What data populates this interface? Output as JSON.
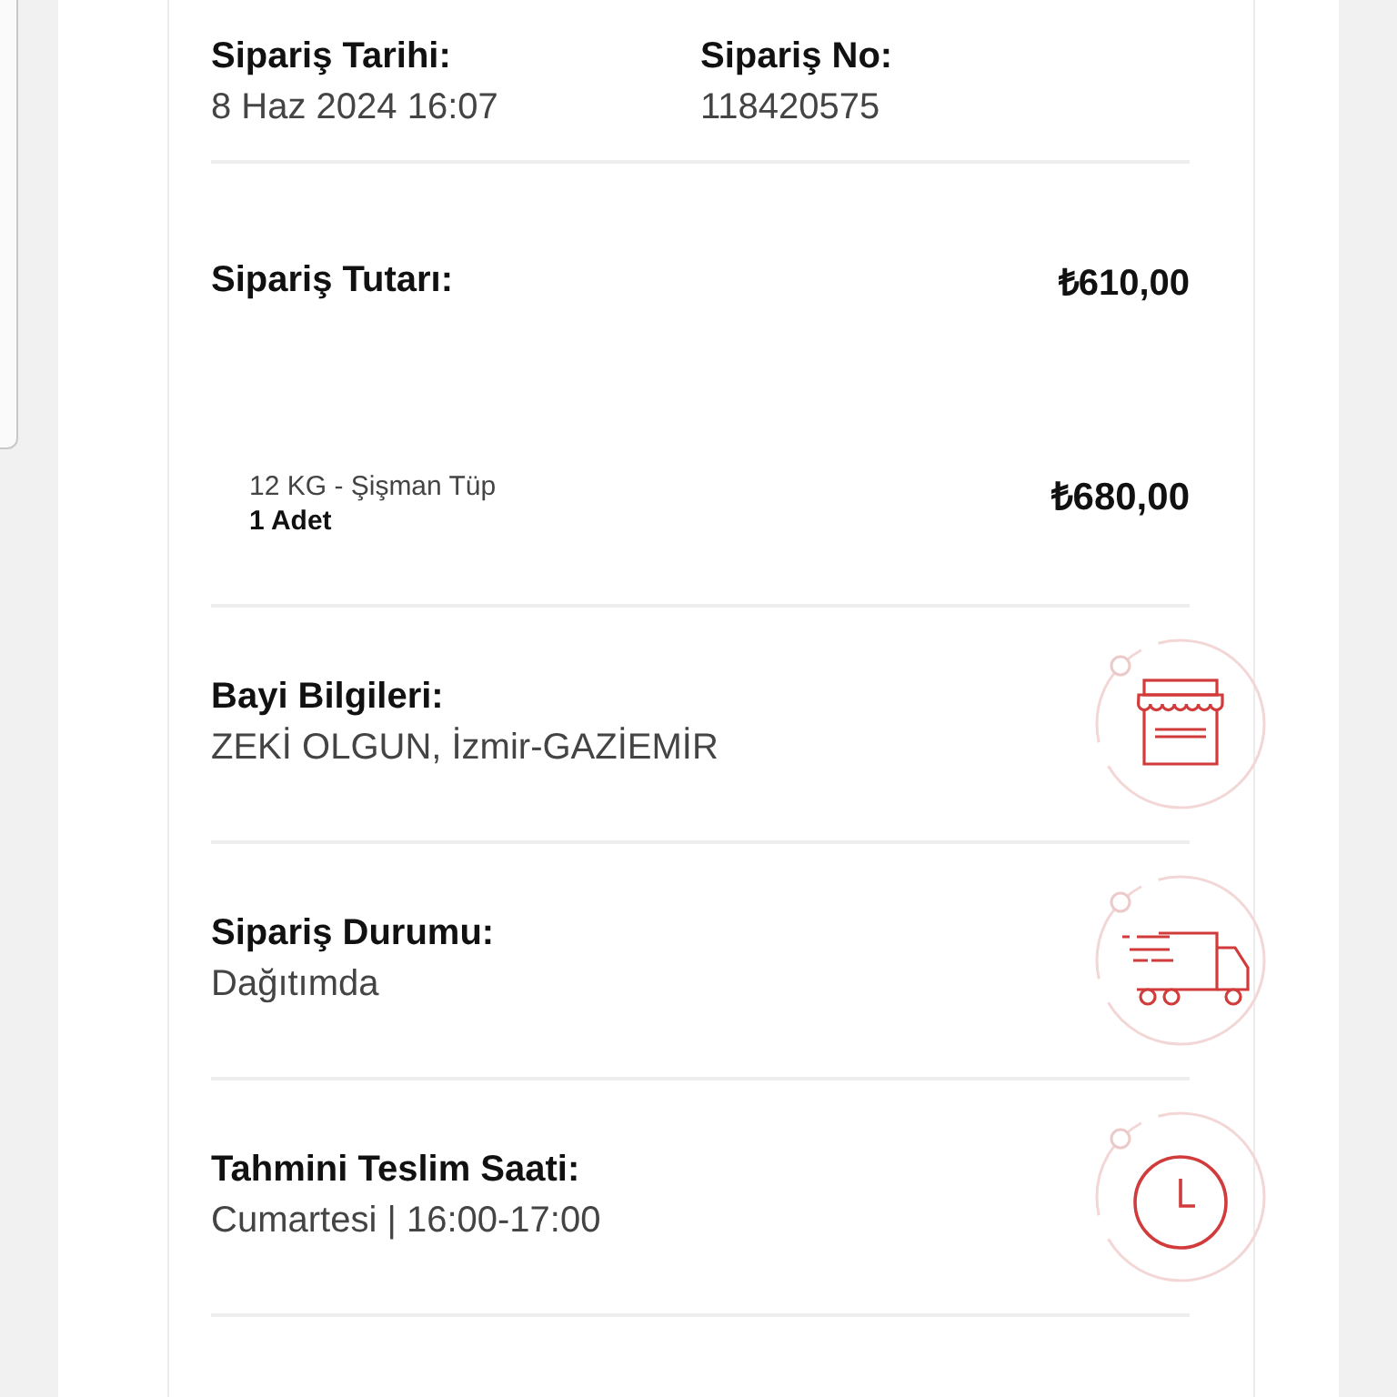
{
  "order_meta": [
    {
      "label": "Sipariş Tarihi:",
      "value": "8 Haz 2024 16:07"
    },
    {
      "label": "Sipariş No:",
      "value": "118420575"
    }
  ],
  "order_total": {
    "label": "Sipariş Tutarı:",
    "amount": "₺610,00"
  },
  "items": [
    {
      "name": "12 KG - Şişman Tüp",
      "quantity": "1 Adet",
      "price": "₺680,00"
    }
  ],
  "info_sections": [
    {
      "label": "Bayi Bilgileri:",
      "value": "ZEKİ OLGUN, İzmir-GAZİEMİR",
      "kind": "store"
    },
    {
      "label": "Sipariş Durumu:",
      "value": "Dağıtımda",
      "kind": "truck"
    },
    {
      "label": "Tahmini Teslim Saati:",
      "value": "Cumartesi | 16:00-17:00",
      "kind": "clock"
    }
  ]
}
